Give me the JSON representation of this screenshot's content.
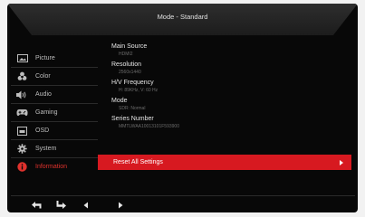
{
  "header": {
    "title": "Mode - Standard"
  },
  "sidebar": {
    "items": [
      {
        "label": "Picture",
        "icon": "picture-icon"
      },
      {
        "label": "Color",
        "icon": "palette-icon"
      },
      {
        "label": "Audio",
        "icon": "speaker-icon"
      },
      {
        "label": "Gaming",
        "icon": "gamepad-icon"
      },
      {
        "label": "OSD",
        "icon": "osd-icon"
      },
      {
        "label": "System",
        "icon": "gear-icon"
      },
      {
        "label": "Information",
        "icon": "info-icon",
        "active": true
      }
    ]
  },
  "info": [
    {
      "label": "Main Source",
      "value": "HDMI2"
    },
    {
      "label": "Resolution",
      "value": "2560x1440"
    },
    {
      "label": "H/V Frequency",
      "value": "H: 89KHz, V: 60 Hz"
    },
    {
      "label": "Mode",
      "value": "SDR: Normal"
    },
    {
      "label": "Series Number",
      "value": "MMTLWAA10013101F593900"
    }
  ],
  "reset": {
    "label": "Reset All Settings"
  },
  "navigation": [
    "back-icon",
    "enter-icon",
    "left-arrow-icon",
    "right-arrow-icon"
  ],
  "colors": {
    "accent": "#d71920",
    "background": "#080808",
    "text": "#e6e6e6",
    "muted": "#6c6c6c"
  }
}
